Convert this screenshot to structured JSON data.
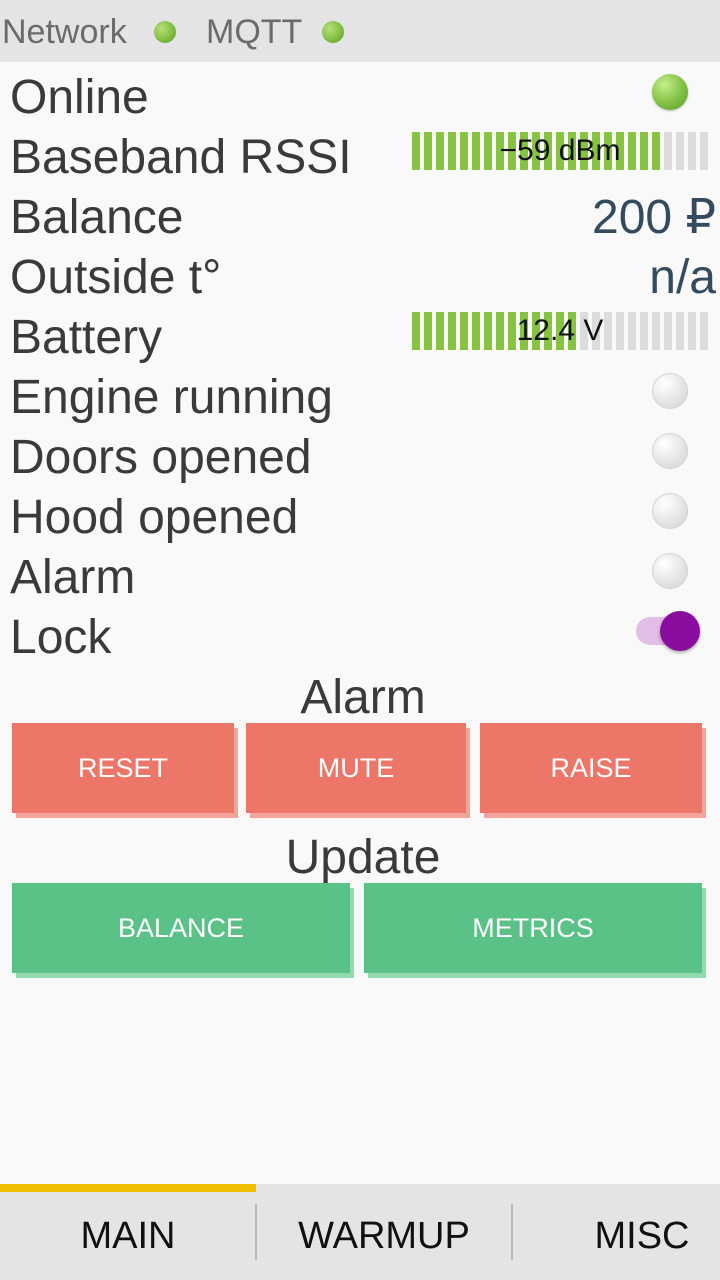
{
  "status": {
    "network_label": "Network",
    "mqtt_label": "MQTT",
    "indicator_color": "#7dbb3c"
  },
  "rows": {
    "online": {
      "label": "Online",
      "state": "on"
    },
    "rssi": {
      "label": "Baseband RSSI",
      "value_text": "−59 dBm",
      "level": 0.85
    },
    "balance": {
      "label": "Balance",
      "value": "200 ₽"
    },
    "outside_temp": {
      "label": "Outside t°",
      "value": "n/a"
    },
    "battery": {
      "label": "Battery",
      "value_text": "12.4 V",
      "level": 0.55
    },
    "engine_running": {
      "label": "Engine running",
      "state": "off"
    },
    "doors_opened": {
      "label": "Doors opened",
      "state": "off"
    },
    "hood_opened": {
      "label": "Hood opened",
      "state": "off"
    },
    "alarm": {
      "label": "Alarm",
      "state": "off"
    },
    "lock": {
      "label": "Lock",
      "state": "on"
    }
  },
  "alarm_section": {
    "title": "Alarm",
    "reset_label": "RESET",
    "mute_label": "MUTE",
    "raise_label": "RAISE",
    "color": "#ec7769"
  },
  "update_section": {
    "title": "Update",
    "balance_label": "BALANCE",
    "metrics_label": "METRICS",
    "color": "#5bc287"
  },
  "tabs": [
    {
      "label": "MAIN",
      "active": true
    },
    {
      "label": "WARMUP",
      "active": false
    },
    {
      "label": "MISC",
      "active": false
    }
  ],
  "accent_color": "#f0be00"
}
